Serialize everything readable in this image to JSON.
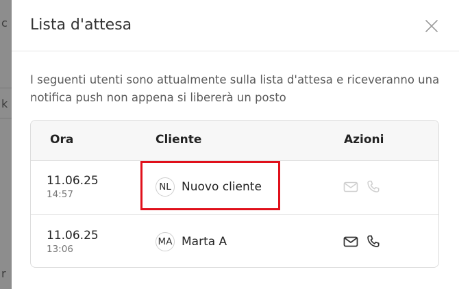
{
  "modal": {
    "title": "Lista d'attesa",
    "description": "I seguenti utenti sono attualmente sulla lista d'attesa e riceveranno una notifica push non appena si libererà un posto",
    "close_icon": "close-icon"
  },
  "table": {
    "headers": {
      "time": "Ora",
      "client": "Cliente",
      "actions": "Azioni"
    },
    "rows": [
      {
        "date": "11.06.25",
        "time": "14:57",
        "initials": "NL",
        "name": "Nuovo cliente",
        "actions_enabled": false,
        "highlighted": true
      },
      {
        "date": "11.06.25",
        "time": "13:06",
        "initials": "MA",
        "name": "Marta A",
        "actions_enabled": true,
        "highlighted": false
      }
    ]
  },
  "icons": {
    "email": "envelope-icon",
    "phone": "phone-icon"
  },
  "colors": {
    "highlight": "#e0101b",
    "icon_active": "#333333",
    "icon_disabled": "#cfcfcf"
  }
}
